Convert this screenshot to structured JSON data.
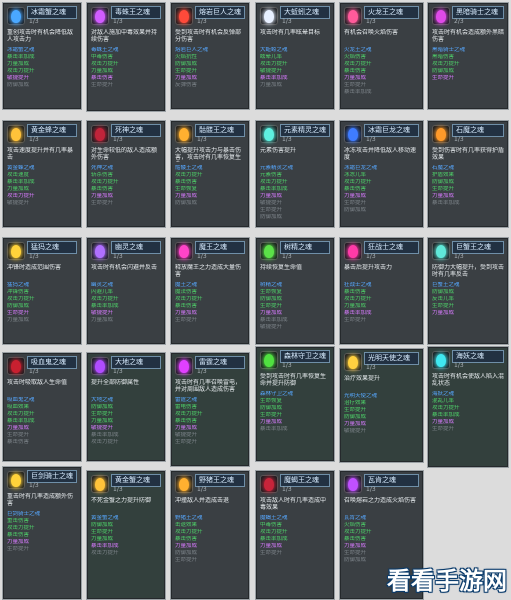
{
  "watermark": "看看手游网",
  "cards": [
    {
      "name": "冰霜蟹之魂",
      "level": "1/3",
      "icon": "blue-flame-icon",
      "icon_color": "#4aa8ff",
      "desc": "重创攻击时有机会降低敌人攻击力",
      "stats": [
        "冰霜蟹之魂",
        "暴击率加成",
        "力量加成",
        "攻击力提升",
        "敏捷提升",
        "防御加成"
      ],
      "theme": "dark"
    },
    {
      "name": "毒蛛王之魂",
      "level": "1/3",
      "icon": "purple-flame-icon",
      "icon_color": "#d05cff",
      "desc": "对敌人施加中毒效果并持续伤害",
      "stats": [
        "毒蛛王之魂",
        "中毒伤害",
        "攻击力提升",
        "力量加成",
        "暴击伤害",
        "生命提升"
      ],
      "theme": "dark"
    },
    {
      "name": "熔岩巨人之魂",
      "level": "1/3",
      "icon": "red-flame-icon",
      "icon_color": "#ff4a3a",
      "desc": "受到攻击时有机会反弹部分伤害",
      "stats": [
        "熔岩巨人之魂",
        "火焰抗性",
        "防御加成",
        "生命提升",
        "力量加成",
        "反弹伤害"
      ],
      "theme": "dark"
    },
    {
      "name": "大蚯蚓之魂",
      "level": "1/3",
      "icon": "white-flame-icon",
      "icon_color": "#e8f0ff",
      "desc": "攻击时有几率眩晕目标",
      "stats": [
        "大蚯蚓之魂",
        "眩晕几率",
        "攻击力提升",
        "敏捷提升",
        "暴击率加成",
        "力量加成"
      ],
      "theme": "dark"
    },
    {
      "name": "火龙王之魂",
      "level": "1/3",
      "icon": "pink-flame-icon",
      "icon_color": "#ff5a9a",
      "desc": "有机会召唤火焰伤害",
      "stats": [
        "火龙王之魂",
        "火焰伤害",
        "攻击力提升",
        "暴击伤害",
        "力量加成",
        "生命提升",
        "暴击率加成"
      ],
      "theme": "dark"
    },
    {
      "name": "黑暗骑士之魂",
      "level": "2/3",
      "icon": "magenta-flame-icon",
      "icon_color": "#e04ae8",
      "desc": "攻击时有机会造成额外黑暗伤害",
      "stats": [
        "黑暗骑士之魂",
        "黑暗伤害",
        "攻击力提升",
        "防御加成",
        "生命提升"
      ],
      "theme": "dark"
    },
    {
      "name": "黄金蜂之魂",
      "level": "1/3",
      "icon": "gold-flame-icon",
      "icon_color": "#ffc23a",
      "desc": "攻击速度提升并有几率暴击",
      "stats": [
        "黄金蜂之魂",
        "攻击速度",
        "暴击率加成",
        "力量加成",
        "攻击力提升",
        "敏捷提升"
      ],
      "theme": "dark"
    },
    {
      "name": "死神之魂",
      "level": "1/3",
      "icon": "crimson-flame-icon",
      "icon_color": "#c0243a",
      "desc": "对生命较低的敌人造成额外伤害",
      "stats": [
        "死神之魂",
        "斩杀伤害",
        "攻击力提升",
        "暴击伤害",
        "力量加成",
        "生命提升"
      ],
      "theme": "dark"
    },
    {
      "name": "骷髅王之魂",
      "level": "1/3",
      "icon": "amber-flame-icon",
      "icon_color": "#ffb030",
      "desc": "大幅提升攻击力与暴击伤害，攻击时有几率恢复生命",
      "stats": [
        "骷髅王之魂",
        "攻击力提升",
        "暴击伤害",
        "生命恢复",
        "力量加成",
        "防御加成"
      ],
      "theme": "dark"
    },
    {
      "name": "元素精灵之魂",
      "level": "1/3",
      "icon": "cyan-flame-icon",
      "icon_color": "#5ef0e0",
      "desc": "元素伤害提升",
      "stats": [
        "元素精灵之魂",
        "元素伤害",
        "攻击力提升",
        "暴击率加成",
        "力量加成",
        "敏捷提升",
        "生命提升",
        "防御加成"
      ],
      "theme": "dark"
    },
    {
      "name": "冰霜巨龙之魂",
      "level": "1/3",
      "icon": "blue-flame-icon",
      "icon_color": "#3f7cff",
      "desc": "冰冻攻击并降低敌人移动速度",
      "stats": [
        "冰霜巨龙之魂",
        "冰冻几率",
        "攻击力提升",
        "暴击伤害",
        "力量加成",
        "生命提升",
        "防御加成"
      ],
      "theme": "dark"
    },
    {
      "name": "石魔之魂",
      "level": "1/3",
      "icon": "orange-flame-icon",
      "icon_color": "#ff9a2a",
      "desc": "受到伤害时有几率获得护盾效果",
      "stats": [
        "石魔之魂",
        "护盾效果",
        "防御加成",
        "生命提升",
        "力量加成",
        "暴击率加成"
      ],
      "theme": "dark"
    },
    {
      "name": "猛犸之魂",
      "level": "1/3",
      "icon": "gold-flame-icon",
      "icon_color": "#ffd23a",
      "desc": "冲锋时造成范围伤害",
      "stats": [
        "猛犸之魂",
        "冲锋伤害",
        "攻击力提升",
        "防御加成",
        "生命提升",
        "力量加成"
      ],
      "theme": "dark"
    },
    {
      "name": "幽灵之魂",
      "level": "1/3",
      "icon": "purple-flame-icon",
      "icon_color": "#b070ff",
      "desc": "攻击时有机会闪避并反击",
      "stats": [
        "幽灵之魂",
        "闪避几率",
        "攻击力提升",
        "暴击率加成",
        "敏捷提升",
        "力量加成"
      ],
      "theme": "dark"
    },
    {
      "name": "魔王之魂",
      "level": "1/3",
      "icon": "magenta-flame-icon",
      "icon_color": "#ff44c8",
      "desc": "释放魔王之力造成大量伤害",
      "stats": [
        "魔王之魂",
        "魔法伤害",
        "攻击力提升",
        "暴击伤害",
        "力量加成",
        "生命提升"
      ],
      "theme": "dark"
    },
    {
      "name": "树精之魂",
      "level": "1/3",
      "icon": "green-flame-icon",
      "icon_color": "#5be048",
      "desc": "持续恢复生命值",
      "stats": [
        "树精之魂",
        "生命恢复",
        "防御加成",
        "生命提升",
        "力量加成",
        "暴击率加成",
        "敏捷提升"
      ],
      "theme": "dark"
    },
    {
      "name": "狂战士之魂",
      "level": "1/3",
      "icon": "magenta-flame-icon",
      "icon_color": "#ff3aa8",
      "desc": "暴击后提升攻击力",
      "stats": [
        "狂战士之魂",
        "暴击伤害",
        "攻击力提升",
        "力量加成",
        "暴击率加成",
        "生命提升"
      ],
      "theme": "dark"
    },
    {
      "name": "巨蟹王之魂",
      "level": "1/3",
      "icon": "cyan-flame-icon",
      "icon_color": "#60e8d8",
      "desc": "防御力大幅提升，受到攻击时有几率反击",
      "stats": [
        "巨蟹王之魂",
        "防御加成",
        "反击几率",
        "生命提升",
        "力量加成"
      ],
      "theme": "dark"
    },
    {
      "name": "吸血鬼之魂",
      "level": "1/3",
      "icon": "crimson-flame-icon",
      "icon_color": "#c82030",
      "desc": "攻击时吸取敌人生命值",
      "stats": [
        "吸血鬼之魂",
        "吸血效果",
        "攻击力提升",
        "暴击率加成",
        "力量加成",
        "生命提升",
        "暴击伤害"
      ],
      "theme": "dark"
    },
    {
      "name": "大地之魂",
      "level": "1/3",
      "icon": "purple-flame-icon",
      "icon_color": "#b04cff",
      "desc": "提升全部防御属性",
      "stats": [
        "大地之魂",
        "防御加成",
        "生命提升",
        "力量加成",
        "敏捷提升",
        "暴击率加成",
        "攻击力提升"
      ],
      "theme": "teal"
    },
    {
      "name": "雷霆之魂",
      "level": "1/3",
      "icon": "magenta-flame-icon",
      "icon_color": "#e040ff",
      "desc": "攻击时有几率召唤雷电，并对周围敌人造成伤害",
      "stats": [
        "雷霆之魂",
        "雷电伤害",
        "攻击力提升",
        "暴击伤害",
        "力量加成",
        "敏捷提升",
        "生命提升"
      ],
      "theme": "teal"
    },
    {
      "name": "森林守卫之魂",
      "level": "1/3",
      "icon": "green-flame-icon",
      "icon_color": "#50e040",
      "desc": "受到攻击时有几率恢复生命并提升防御",
      "stats": [
        "森林守卫之魂",
        "生命恢复",
        "防御加成",
        "生命提升",
        "力量加成",
        "暴击率加成"
      ],
      "theme": "teal"
    },
    {
      "name": "光明天使之魂",
      "level": "1/3",
      "icon": "gold-flame-icon",
      "icon_color": "#ffd040",
      "desc": "治疗效果提升",
      "stats": [
        "光明天使之魂",
        "治疗效果",
        "生命提升",
        "防御加成",
        "力量加成",
        "敏捷提升"
      ],
      "theme": "teal"
    },
    {
      "name": "海妖之魂",
      "level": "1/3",
      "icon": "cyan-flame-icon",
      "icon_color": "#40e8f0",
      "desc": "攻击时有机会使敌人陷入混乱状态",
      "stats": [
        "海妖之魂",
        "混乱几率",
        "攻击力提升",
        "暴击率加成",
        "力量加成",
        "生命提升"
      ],
      "theme": "teal"
    },
    {
      "name": "巨剑骑士之魂",
      "level": "1/3",
      "icon": "gold-flame-icon",
      "icon_color": "#ffd23a",
      "desc": "重击时有几率造成额外伤害",
      "stats": [
        "巨剑骑士之魂",
        "重击伤害",
        "攻击力提升",
        "暴击伤害",
        "力量加成",
        "生命提升"
      ],
      "theme": "dark"
    },
    {
      "name": "黄金蟹之魂",
      "level": "1/3",
      "icon": "gold-flame-icon",
      "icon_color": "#ffc23a",
      "desc": "不死金蟹之力提升防御",
      "stats": [
        "黄金蟹之魂",
        "防御加成",
        "生命提升",
        "力量加成",
        "暴击率加成",
        "攻击力提升"
      ],
      "theme": "teal"
    },
    {
      "name": "野猪王之魂",
      "level": "1/3",
      "icon": "amber-flame-icon",
      "icon_color": "#ffb030",
      "desc": "冲撞敌人并造成击退",
      "stats": [
        "野猪王之魂",
        "击退效果",
        "攻击力提升",
        "暴击伤害",
        "力量加成",
        "防御加成",
        "生命提升"
      ],
      "theme": "dark"
    },
    {
      "name": "魔蝎王之魂",
      "level": "1/3",
      "icon": "crimson-flame-icon",
      "icon_color": "#c8243a",
      "desc": "攻击敌人时有几率造成中毒效果",
      "stats": [
        "魔蝎王之魂",
        "中毒伤害",
        "攻击力提升",
        "暴击率加成",
        "力量加成",
        "生命提升"
      ],
      "theme": "dark"
    },
    {
      "name": "瓦肯之魂",
      "level": "1/3",
      "icon": "purple-flame-icon",
      "icon_color": "#c050ff",
      "desc": "召唤熔岩之力造成火焰伤害",
      "stats": [
        "瓦肯之魂",
        "火焰伤害",
        "攻击力提升",
        "暴击伤害",
        "力量加成",
        "生命提升",
        "防御加成"
      ],
      "theme": "dark"
    }
  ]
}
